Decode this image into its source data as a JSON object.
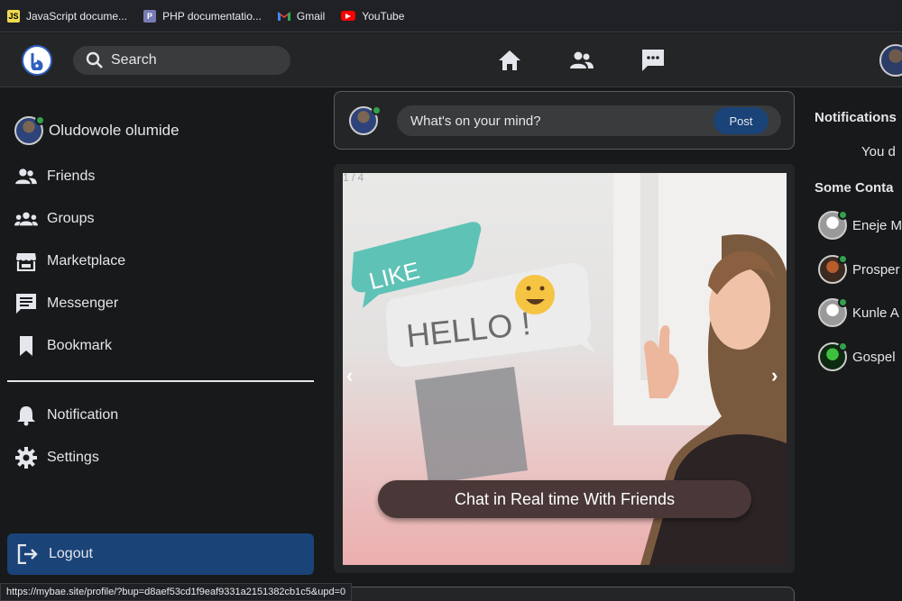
{
  "bookmarks": [
    {
      "label": "JavaScript docume...",
      "icon": "js-doc-icon",
      "color": "#f0db4f"
    },
    {
      "label": "PHP documentatio...",
      "icon": "php-doc-icon",
      "color": "#777bb3"
    },
    {
      "label": "Gmail",
      "icon": "gmail-icon",
      "color": "#ea4335"
    },
    {
      "label": "YouTube",
      "icon": "youtube-icon",
      "color": "#ff0000"
    }
  ],
  "nav": {
    "search_placeholder": "Search",
    "icons": [
      "home-icon",
      "friends-icon",
      "messenger-icon"
    ]
  },
  "sidebar": {
    "profile_name": "Oludowole olumide",
    "items": [
      {
        "label": "Friends",
        "icon": "friends-icon"
      },
      {
        "label": "Groups",
        "icon": "groups-icon"
      },
      {
        "label": "Marketplace",
        "icon": "store-icon"
      },
      {
        "label": "Messenger",
        "icon": "message-icon"
      },
      {
        "label": "Bookmark",
        "icon": "bookmark-icon"
      },
      {
        "label": "Notification",
        "icon": "bell-icon"
      },
      {
        "label": "Settings",
        "icon": "gear-icon"
      }
    ],
    "logout_label": "Logout"
  },
  "composer": {
    "placeholder": "What's on your mind?",
    "post_label": "Post"
  },
  "carousel": {
    "counter": "1 / 4",
    "caption": "Chat in Real time With Friends",
    "bubble_like": "LIKE",
    "bubble_hello": "HELLO !"
  },
  "right": {
    "notifications_title": "Notifications",
    "notifications_text": "You d",
    "contacts_title": "Some Conta",
    "contacts": [
      {
        "name": "Eneje M"
      },
      {
        "name": "Prosper"
      },
      {
        "name": "Kunle A"
      },
      {
        "name": "Gospel"
      }
    ]
  },
  "status_url": "https://mybae.site/profile/?bup=d8aef53cd1f9eaf9331a2151382cb1c5&upd=0",
  "colors": {
    "accent": "#1a4378",
    "online": "#31a24c",
    "background": "#18191a",
    "surface": "#242526"
  }
}
